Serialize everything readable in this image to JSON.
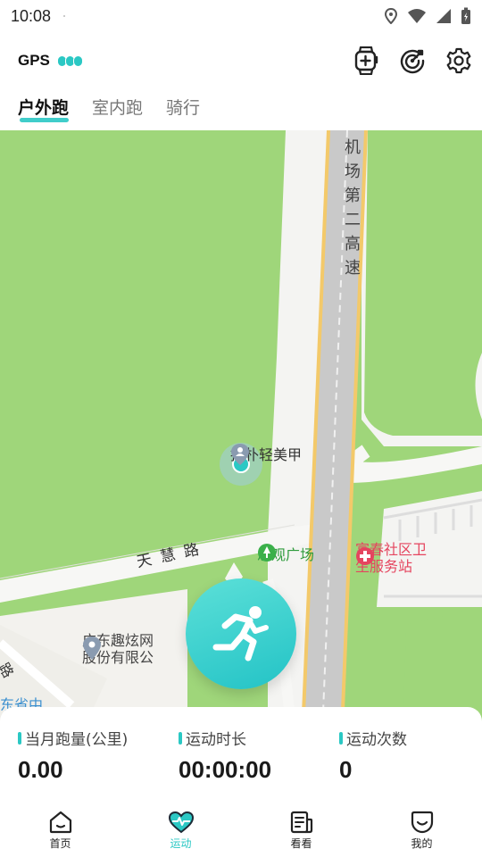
{
  "status_bar": {
    "time": "10:08"
  },
  "header": {
    "gps_label": "GPS",
    "actions": [
      {
        "icon": "watch-add-icon"
      },
      {
        "icon": "target-icon"
      },
      {
        "icon": "gear-icon"
      }
    ],
    "tabs": [
      {
        "label": "户外跑",
        "active": true
      },
      {
        "label": "室内跑",
        "active": false
      },
      {
        "label": "骑行",
        "active": false
      }
    ]
  },
  "map": {
    "highway_label": [
      "机",
      "场",
      "第",
      "二",
      "高",
      "速"
    ],
    "road_label": [
      "天",
      "慧",
      "路"
    ],
    "poi_nail": "指朴轻美甲",
    "poi_plaza": "思观广场",
    "poi_clinic_line1": "富春社区卫",
    "poi_clinic_line2": "生服务站",
    "poi_company_line1": "广东趣炫网",
    "poi_company_line2": "股份有限公",
    "road_corner": "路",
    "area_label": "东省中"
  },
  "stats": {
    "monthly_distance": {
      "label": "当月跑量(公里)",
      "value": "0.00"
    },
    "duration": {
      "label": "运动时长",
      "value": "00:00:00"
    },
    "count": {
      "label": "运动次数",
      "value": "0"
    }
  },
  "nav": [
    {
      "label": "首页",
      "icon": "home-icon",
      "active": false
    },
    {
      "label": "运动",
      "icon": "heart-pulse-icon",
      "active": true
    },
    {
      "label": "看看",
      "icon": "news-icon",
      "active": false
    },
    {
      "label": "我的",
      "icon": "smile-icon",
      "active": false
    }
  ],
  "colors": {
    "accent": "#2bc8c4",
    "map_green": "#9fd67a",
    "road": "#f2f2f0",
    "highway": "#f5c768"
  }
}
